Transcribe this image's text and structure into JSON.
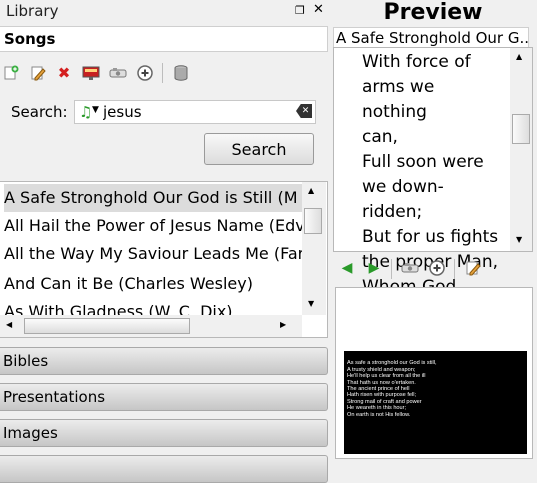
{
  "library": {
    "title": "Library",
    "float_glyph": "❐",
    "close_glyph": "✕",
    "section": "Songs",
    "toolbar_icons": [
      "new-song-icon",
      "edit-song-icon",
      "delete-song-icon",
      "preview-icon",
      "send-live-icon",
      "add-to-service-icon",
      "import-icon"
    ],
    "search": {
      "label": "Search:",
      "value": "jesus"
    },
    "search_button": "Search",
    "results": [
      "A Safe Stronghold Our God is Still (M",
      "All Hail the Power of Jesus Name (Edv",
      "All the Way My Saviour Leads Me (Far",
      "And Can it Be (Charles Wesley)",
      "As With Gladness (W. C. Dix)"
    ],
    "categories": [
      "Bibles",
      "Presentations",
      "Images"
    ]
  },
  "preview": {
    "title": "Preview",
    "song_title": "A Safe Stronghold Our G...",
    "verse_text": "With force of\narms we nothing\ncan,\nFull soon were\nwe down-ridden;\nBut for us fights\nthe proper Man,\nWhom God",
    "toolbar_icons": [
      "previous-icon",
      "next-icon",
      "send-live-icon",
      "add-to-service-icon",
      "edit-icon"
    ],
    "slide_text": "As safe a stronghold our God is still,\nA trusty shield and weapon;\nHe'll help us clear from all the ill\nThat hath us now o'ertaken.\nThe ancient prince of hell\nHath risen with purpose fell;\nStrong mail of craft and power\nHe weareth in this hour;\nOn earth is not His fellow."
  },
  "colors": {
    "accent_green": "#2a9a2a",
    "delete_red": "#d42020"
  }
}
